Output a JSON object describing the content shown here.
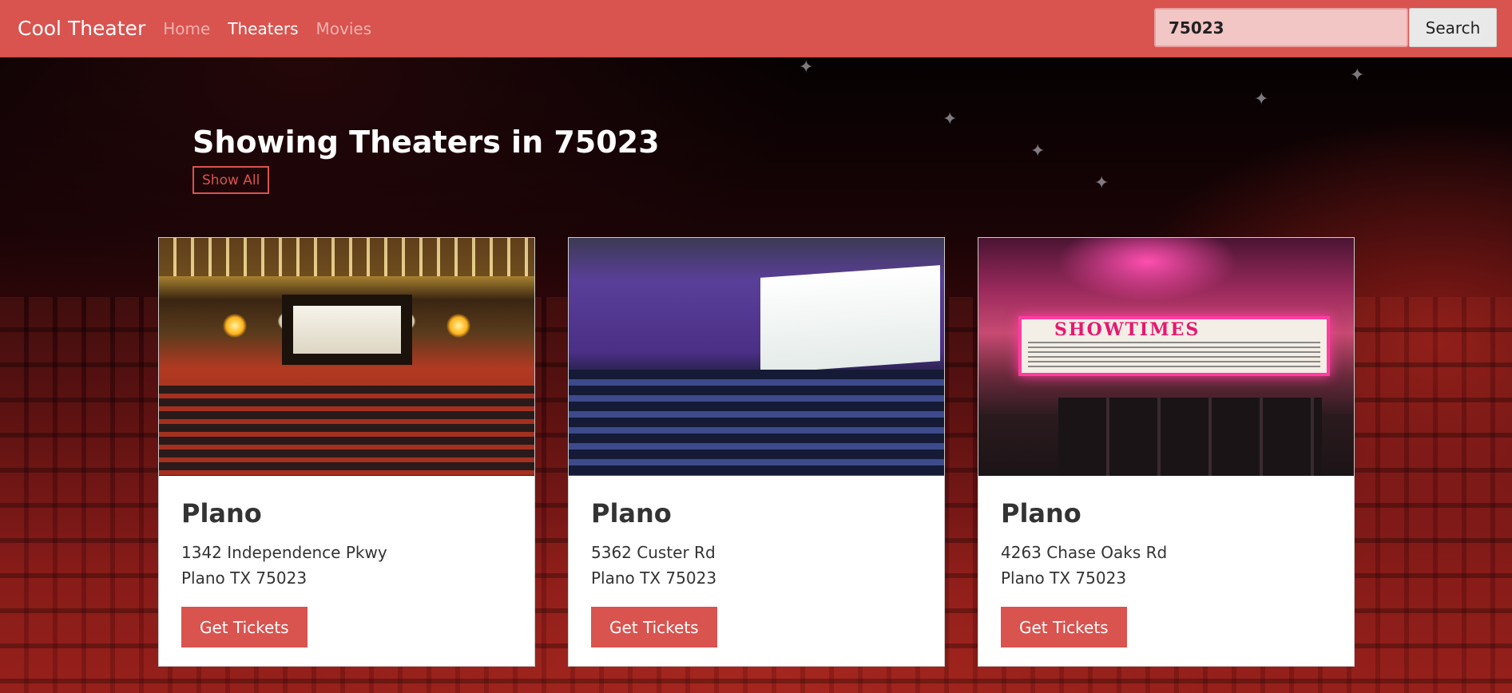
{
  "navbar": {
    "brand": "Cool Theater",
    "links": [
      {
        "label": "Home",
        "active": false
      },
      {
        "label": "Theaters",
        "active": true
      },
      {
        "label": "Movies",
        "active": false
      }
    ],
    "search_value": "75023",
    "search_button": "Search"
  },
  "main": {
    "title": "Showing Theaters in 75023",
    "show_all_label": "Show All"
  },
  "theaters": [
    {
      "city": "Plano",
      "street": "1342 Independence Pkwy",
      "city_line": "Plano TX 75023",
      "button": "Get Tickets"
    },
    {
      "city": "Plano",
      "street": "5362 Custer Rd",
      "city_line": "Plano TX 75023",
      "button": "Get Tickets"
    },
    {
      "city": "Plano",
      "street": "4263 Chase Oaks Rd",
      "city_line": "Plano TX 75023",
      "button": "Get Tickets"
    }
  ],
  "images": {
    "marquee_text": "SHOWTIMES"
  },
  "colors": {
    "accent": "#d9534f",
    "navbar_bg": "#d9534f",
    "search_bg": "#f2c6c5"
  }
}
